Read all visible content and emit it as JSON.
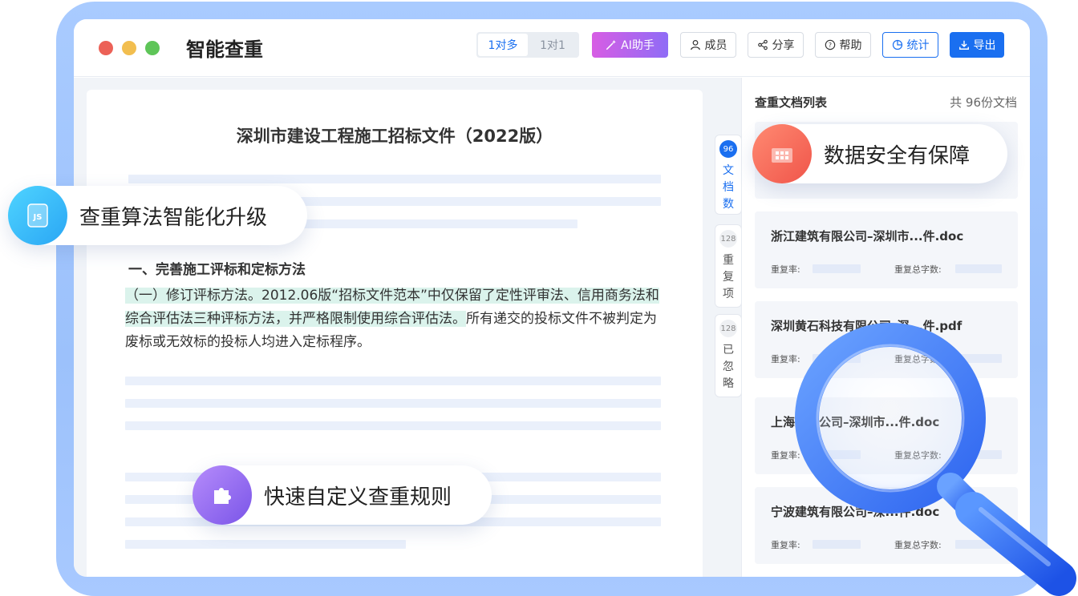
{
  "window": {
    "app_title": "智能查重",
    "mode_tabs": [
      {
        "label": "1对多",
        "active": true
      },
      {
        "label": "1对1",
        "active": false
      }
    ],
    "toolbar": {
      "ai_label": "AI助手",
      "members_label": "成员",
      "share_label": "分享",
      "help_label": "帮助",
      "stats_label": "统计",
      "export_label": "导出"
    }
  },
  "document": {
    "title": "深圳市建设工程施工招标文件（2022版）",
    "section_heading": "一、完善施工评标和定标方法",
    "paragraph_highlighted": "（一）修订评标方法。2012.06版“招标文件范本”中仅保留了定性评审法、信用商务法和综合评估法三种评标方法，并严格限制使用综合评估法。",
    "paragraph_rest": "所有递交的投标文件不被判定为废标或无效标的投标人均进入定标程序。"
  },
  "vertical_tabs": [
    {
      "count": "96",
      "label": "文档数",
      "active": true
    },
    {
      "count": "128",
      "label": "重复项",
      "active": false
    },
    {
      "count": "128",
      "label": "已忽略",
      "active": false
    }
  ],
  "sidebar": {
    "title": "查重文档列表",
    "count_text": "共 96份文档",
    "metric_labels": {
      "repeat_rate": "重复率:",
      "repeat_words": "重复总字数:"
    },
    "documents": [
      {
        "name": "浙江建筑有限公司–深圳市...件.doc"
      },
      {
        "name": "深圳黄石科技有限公司–深...件.pdf"
      },
      {
        "name": "上海开天公司–深圳市...件.doc"
      },
      {
        "name": "宁波建筑有限公司–深...件.doc"
      }
    ]
  },
  "features": {
    "algorithm": "查重算法智能化升级",
    "security": "数据安全有保障",
    "custom_rules": "快速自定义查重规则",
    "algorithm_icon_text": "JS"
  },
  "colors": {
    "accent": "#1a6ff0",
    "highlight": "#dbf3ec",
    "frame": "#a9cbff"
  }
}
